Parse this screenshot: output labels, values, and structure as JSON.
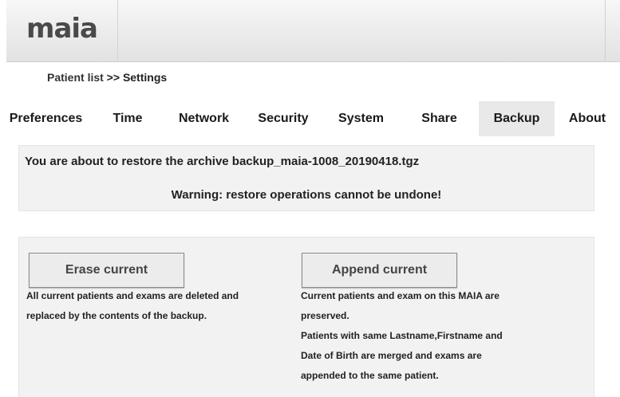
{
  "app": {
    "logo": "maia"
  },
  "breadcrumb": {
    "link": "Patient list",
    "separator": " >> ",
    "current": "Settings"
  },
  "tabs": [
    {
      "label": "Preferences"
    },
    {
      "label": "Time"
    },
    {
      "label": "Network"
    },
    {
      "label": "Security"
    },
    {
      "label": "System"
    },
    {
      "label": "Share"
    },
    {
      "label": "Backup",
      "active": true
    },
    {
      "label": "About"
    }
  ],
  "restore": {
    "message": "You are about to restore the archive backup_maia-1008_20190418.tgz",
    "warning": "Warning: restore operations cannot be undone!"
  },
  "erase": {
    "button_label": "Erase current",
    "line1": "All current patients and exams are deleted and",
    "line2": "replaced by the contents of the backup."
  },
  "append": {
    "button_label": "Append current",
    "line1": "Current patients and exam on this MAIA are",
    "line2": "preserved.",
    "line3": "Patients with same Lastname,Firstname and",
    "line4": "Date of Birth are merged and exams are",
    "line5": "appended to the same patient."
  },
  "colors": {
    "active_tab": "#e9e9e9",
    "panel": "#f2f2f2",
    "header": "#e2e2e2"
  }
}
